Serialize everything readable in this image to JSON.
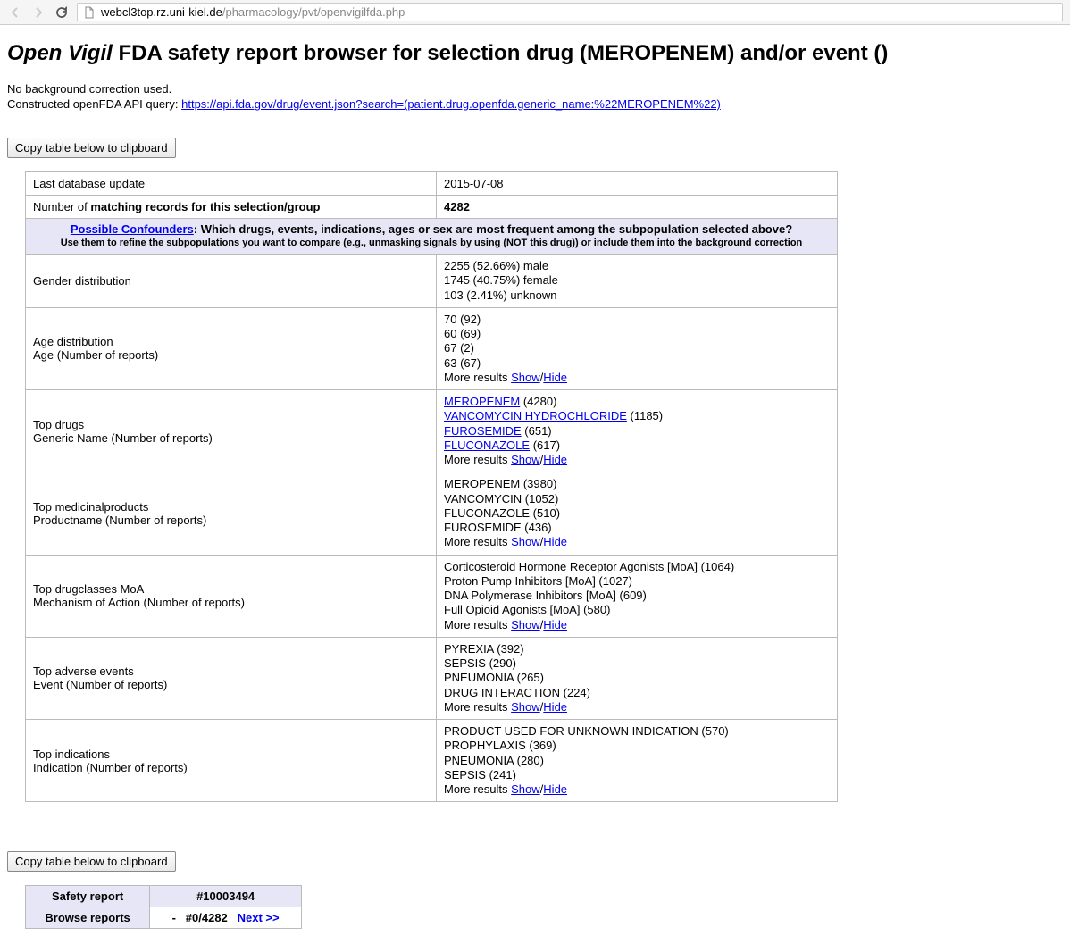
{
  "browser": {
    "url_host": "webcl3top.rz.uni-kiel.de",
    "url_path": "/pharmacology/pvt/openvigilfda.php"
  },
  "page": {
    "title_prefix": "Open Vigil",
    "title_rest": " FDA safety report browser for selection drug (MEROPENEM) and/or event ()",
    "bg_line": "No background correction used.",
    "api_label": "Constructed openFDA API query: ",
    "api_url": "https://api.fda.gov/drug/event.json?search=(patient.drug.openfda.generic_name:%22MEROPENEM%22)",
    "copy_btn": "Copy table below to clipboard"
  },
  "summary": {
    "last_update_label": "Last database update",
    "last_update_value": "2015-07-08",
    "match_label_pre": "Number of ",
    "match_label_bold": "matching records for this selection/group",
    "match_value": "4282"
  },
  "confounders": {
    "link": "Possible Confounders",
    "rest": ": Which drugs, events, indications, ages or sex are most frequent among the subpopulation selected above?",
    "sub": "Use them to refine the subpopulations you want to compare (e.g., unmasking signals by using (NOT this drug)) or include them into the background correction"
  },
  "rows": {
    "gender": {
      "label": "Gender distribution",
      "items": [
        "2255 (52.66%) male",
        "1745 (40.75%) female",
        "103 (2.41%) unknown"
      ]
    },
    "age": {
      "label1": "Age distribution",
      "label2": "Age (Number of reports)",
      "items": [
        "70 (92)",
        "60 (69)",
        "67 (2)",
        "63 (67)"
      ]
    },
    "drugs": {
      "label1": "Top drugs",
      "label2": "Generic Name (Number of reports)",
      "links": [
        {
          "name": "MEROPENEM",
          "count": " (4280)"
        },
        {
          "name": "VANCOMYCIN HYDROCHLORIDE",
          "count": " (1185)"
        },
        {
          "name": "FUROSEMIDE",
          "count": " (651)"
        },
        {
          "name": "FLUCONAZOLE",
          "count": " (617)"
        }
      ]
    },
    "products": {
      "label1": "Top medicinalproducts",
      "label2": "Productname (Number of reports)",
      "items": [
        "MEROPENEM (3980)",
        "VANCOMYCIN (1052)",
        "FLUCONAZOLE (510)",
        "FUROSEMIDE (436)"
      ]
    },
    "classes": {
      "label1": "Top drugclasses MoA",
      "label2": "Mechanism of Action (Number of reports)",
      "items": [
        "Corticosteroid Hormone Receptor Agonists [MoA] (1064)",
        "Proton Pump Inhibitors [MoA] (1027)",
        "DNA Polymerase Inhibitors [MoA] (609)",
        "Full Opioid Agonists [MoA] (580)"
      ]
    },
    "events": {
      "label1": "Top adverse events",
      "label2": "Event (Number of reports)",
      "items": [
        "PYREXIA (392)",
        "SEPSIS (290)",
        "PNEUMONIA (265)",
        "DRUG INTERACTION (224)"
      ]
    },
    "indications": {
      "label1": "Top indications",
      "label2": "Indication (Number of reports)",
      "items": [
        "PRODUCT USED FOR UNKNOWN INDICATION (570)",
        "PROPHYLAXIS (369)",
        "PNEUMONIA (280)",
        "SEPSIS (241)"
      ]
    }
  },
  "more": {
    "prefix": "More results ",
    "show": "Show",
    "sep": "/",
    "hide": "Hide"
  },
  "report_nav": {
    "header1": "Safety report",
    "header2": "#10003494",
    "browse_label": "Browse reports",
    "dash": "-",
    "pos": "#0/4282",
    "next": "Next >>"
  }
}
